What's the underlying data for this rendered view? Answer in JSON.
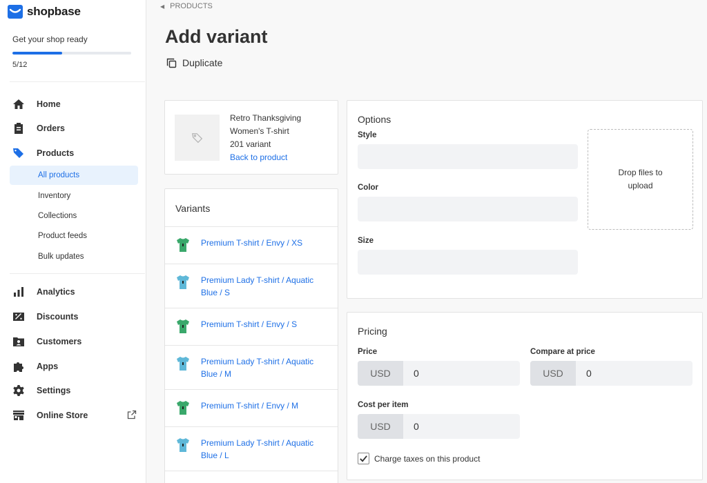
{
  "brand": {
    "name": "shopbase",
    "accent": "#1d6fe6"
  },
  "setup": {
    "title": "Get your shop ready",
    "count": "5/12",
    "progress": 0.42
  },
  "nav": {
    "home": "Home",
    "orders": "Orders",
    "products": "Products",
    "sub": [
      "All products",
      "Inventory",
      "Collections",
      "Product feeds",
      "Bulk updates"
    ],
    "analytics": "Analytics",
    "discounts": "Discounts",
    "customers": "Customers",
    "apps": "Apps",
    "settings": "Settings",
    "online_store": "Online Store"
  },
  "breadcrumb": "PRODUCTS",
  "page_title": "Add variant",
  "duplicate_label": "Duplicate",
  "product": {
    "line1": "Retro Thanksgiving",
    "line2": "Women's T-shirt",
    "line3": "201 variant",
    "back_link": "Back to product"
  },
  "variants": {
    "title": "Variants",
    "items": [
      {
        "label": "Premium T-shirt / Envy / XS",
        "color": "#3aa86b"
      },
      {
        "label": "Premium Lady T-shirt / Aquatic Blue / S",
        "color": "#5fb8d8"
      },
      {
        "label": "Premium T-shirt / Envy / S",
        "color": "#3aa86b"
      },
      {
        "label": "Premium Lady T-shirt / Aquatic Blue / M",
        "color": "#5fb8d8"
      },
      {
        "label": "Premium T-shirt / Envy / M",
        "color": "#3aa86b"
      },
      {
        "label": "Premium Lady T-shirt / Aquatic Blue / L",
        "color": "#5fb8d8"
      }
    ]
  },
  "options": {
    "title": "Options",
    "style_label": "Style",
    "color_label": "Color",
    "size_label": "Size",
    "dropzone_text": "Drop files to upload"
  },
  "pricing": {
    "title": "Pricing",
    "price_label": "Price",
    "compare_label": "Compare at price",
    "cost_label": "Cost per item",
    "currency": "USD",
    "price_value": "0",
    "compare_value": "0",
    "cost_value": "0",
    "charge_taxes_label": "Charge taxes on this product",
    "charge_taxes_checked": true
  }
}
